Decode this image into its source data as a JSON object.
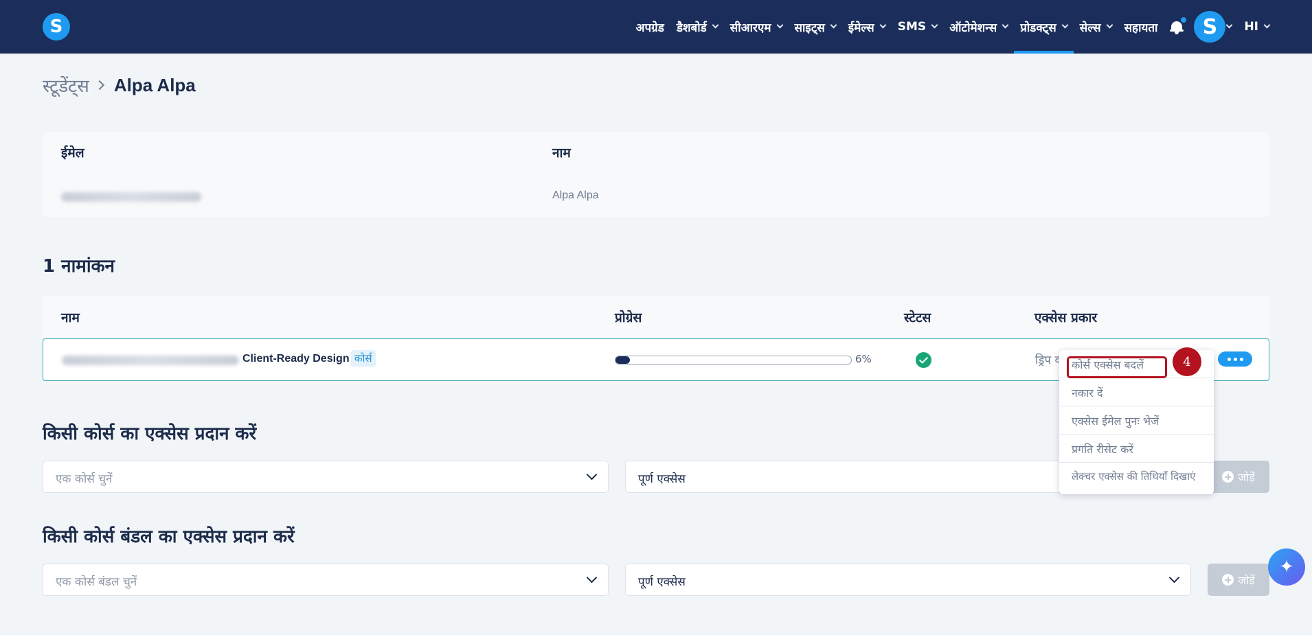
{
  "nav": {
    "items": [
      {
        "label": "अपग्रेड",
        "has_dropdown": false
      },
      {
        "label": "डैशबोर्ड",
        "has_dropdown": true
      },
      {
        "label": "सीआरएम",
        "has_dropdown": true
      },
      {
        "label": "साइट्स",
        "has_dropdown": true
      },
      {
        "label": "ईमेल्स",
        "has_dropdown": true
      },
      {
        "label": "SMS",
        "has_dropdown": true
      },
      {
        "label": "ऑटोमेशन्स",
        "has_dropdown": true
      },
      {
        "label": "प्रोडक्ट्स",
        "has_dropdown": true,
        "active": true
      },
      {
        "label": "सेल्स",
        "has_dropdown": true
      },
      {
        "label": "सहायता",
        "has_dropdown": false
      }
    ],
    "logo_letter": "S",
    "avatar_letter": "S",
    "language": "HI",
    "accent_color": "#1e9bf0",
    "bg_color": "#1b2d5a"
  },
  "breadcrumb": {
    "parent": "स्टूडेंट्स",
    "current": "Alpa Alpa"
  },
  "student": {
    "email_header": "ईमेल",
    "name_header": "नाम",
    "name_value": "Alpa Alpa"
  },
  "enrollments": {
    "title": "1 नामांकन",
    "columns": {
      "name": "नाम",
      "progress": "प्रोग्रेस",
      "status": "स्टेटस",
      "access_type": "एक्सेस प्रकार"
    },
    "row": {
      "course_title_visible": "Client-Ready Design",
      "tag": "कोर्स",
      "progress_percent": 6,
      "progress_label": "6%",
      "status": "complete",
      "access_partial": "ड्रिप व"
    }
  },
  "menu": {
    "items": [
      "कोर्स एक्सेस बदलें",
      "नकार दें",
      "एक्सेस ईमेल पुनः भेजें",
      "प्रगति रीसेट करें",
      "लेक्चर एक्सेस की तिथियाँ दिखाएं"
    ],
    "step_number": "4",
    "highlight_color": "#b3121f"
  },
  "grant_course": {
    "title": "किसी कोर्स का एक्सेस प्रदान करें",
    "select_placeholder": "एक कोर्स चुनें",
    "access_value": "पूर्ण एक्सेस",
    "add_label": "जोड़ें"
  },
  "grant_bundle": {
    "title": "किसी कोर्स बंडल का एक्सेस प्रदान करें",
    "select_placeholder": "एक कोर्स बंडल चुनें",
    "access_value": "पूर्ण एक्सेस",
    "add_label": "जोड़ें"
  }
}
